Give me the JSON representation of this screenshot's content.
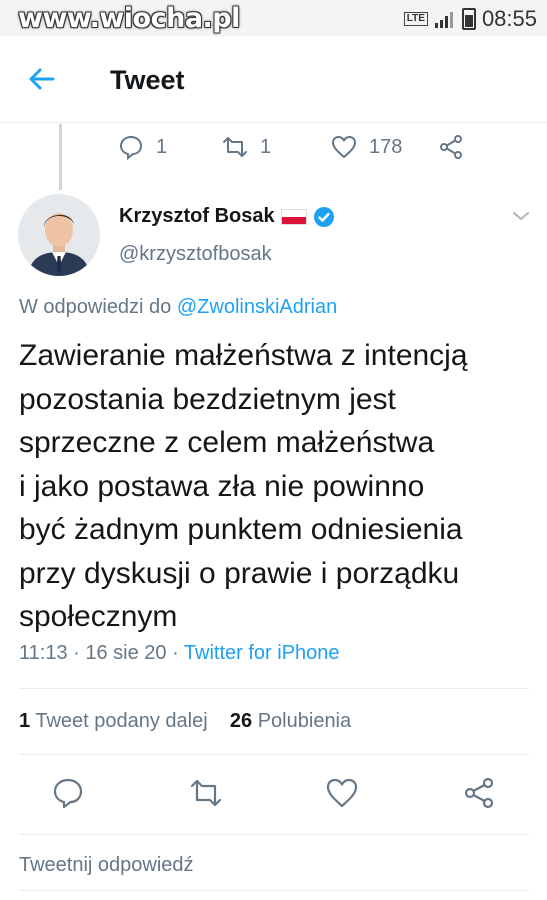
{
  "status_bar": {
    "watermark": "www.wiocha.pl",
    "network": "LTE",
    "time": "08:55"
  },
  "header": {
    "title": "Tweet",
    "back_icon": "arrow-left-icon"
  },
  "previous_tweet_actions": {
    "replies": "1",
    "retweets": "1",
    "likes": "178"
  },
  "author": {
    "name": "Krzysztof Bosak",
    "handle": "@krzysztofbosak",
    "flag": "poland-flag-icon",
    "verified": true
  },
  "tweet": {
    "reply_prefix": "W odpowiedzi do",
    "reply_mention": "@ZwolinskiAdrian",
    "lines": [
      "Zawieranie małżeństwa z intencją",
      "pozostania bezdzietnym jest",
      "sprzeczne z celem małżeństwa",
      "i jako postawa zła nie powinno",
      "być żadnym punktem odniesienia",
      "przy dyskusji o prawie i porządku",
      "społecznym"
    ],
    "timestamp": "11:13 · 16 sie 20 · ",
    "source": "Twitter for iPhone"
  },
  "stats": {
    "retweet_count": "1",
    "retweet_label": "Tweet podany dalej",
    "like_count": "26",
    "like_label": "Polubienia"
  },
  "reply_box": {
    "placeholder": "Tweetnij odpowiedź"
  },
  "colors": {
    "accent": "#1da1f2",
    "secondary_text": "#657786",
    "divider": "#e6ecf0"
  }
}
